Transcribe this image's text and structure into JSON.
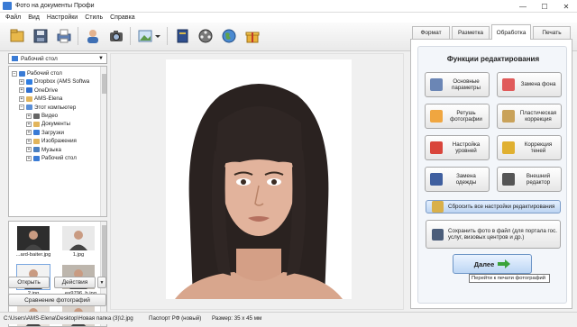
{
  "window": {
    "title": "Фото на документы Профи"
  },
  "menu": [
    "Файл",
    "Вид",
    "Настройки",
    "Стиль",
    "Справка"
  ],
  "toolbar_icons": [
    "open-icon",
    "save-icon",
    "print-icon",
    "person-icon",
    "camera-icon",
    "image-icon",
    "book-icon",
    "film-icon",
    "globe-icon",
    "gift-icon"
  ],
  "left": {
    "folder_select": "Рабочий стол",
    "tree": [
      {
        "label": "Рабочий стол",
        "indent": 0,
        "exp": "−",
        "color": "#3a7bd5"
      },
      {
        "label": "Dropbox (AMS Softwa",
        "indent": 1,
        "exp": "+",
        "color": "#2f7de1"
      },
      {
        "label": "OneDrive",
        "indent": 1,
        "exp": "+",
        "color": "#2f6fcf"
      },
      {
        "label": "AMS-Elena",
        "indent": 1,
        "exp": "+",
        "color": "#e2b55c"
      },
      {
        "label": "Этот компьютер",
        "indent": 1,
        "exp": "−",
        "color": "#5b8fd6"
      },
      {
        "label": "Видео",
        "indent": 2,
        "exp": "+",
        "color": "#666666"
      },
      {
        "label": "Документы",
        "indent": 2,
        "exp": "+",
        "color": "#e2b55c"
      },
      {
        "label": "Загрузки",
        "indent": 2,
        "exp": "+",
        "color": "#3a7bd5"
      },
      {
        "label": "Изображения",
        "indent": 2,
        "exp": "+",
        "color": "#e2b55c"
      },
      {
        "label": "Музыка",
        "indent": 2,
        "exp": "+",
        "color": "#4a7fc0"
      },
      {
        "label": "Рабочий стол",
        "indent": 2,
        "exp": "+",
        "color": "#3a7bd5"
      }
    ],
    "thumbnails": [
      {
        "caption": "...ard-baiter.jpg",
        "bg": "#2d2d2d"
      },
      {
        "caption": "1.jpg",
        "bg": "#e9e9e9"
      },
      {
        "caption": "2.jpg",
        "bg": "#f2f2f2"
      },
      {
        "caption": "...ea9796_b.jpg",
        "bg": "#bdb6ad"
      },
      {
        "caption": "",
        "bg": "#e6e0da"
      },
      {
        "caption": "",
        "bg": "#d9d2cb"
      }
    ],
    "open_btn": "Открыть",
    "actions_btn": "Действия",
    "compare_btn": "Сравнение фотографий"
  },
  "tabs": [
    "Формат",
    "Разметка",
    "Обработка",
    "Печать"
  ],
  "active_tab": "Обработка",
  "panel": {
    "title": "Функции редактирования",
    "buttons": [
      {
        "label": "Основные параметры",
        "icon": "gear-icon",
        "color": "#6b86b5"
      },
      {
        "label": "Замена фона",
        "icon": "paint-bucket-icon",
        "color": "#e05a5a"
      },
      {
        "label": "Ретушь фотографии",
        "icon": "retouch-icon",
        "color": "#f0a640"
      },
      {
        "label": "Пластическая коррекция",
        "icon": "wand-icon",
        "color": "#c9a25a"
      },
      {
        "label": "Настройка уровней",
        "icon": "levels-icon",
        "color": "#d9453b"
      },
      {
        "label": "Коррекция теней",
        "icon": "shadow-icon",
        "color": "#e0b030"
      },
      {
        "label": "Замена одежды",
        "icon": "clothes-icon",
        "color": "#3f5f9f"
      },
      {
        "label": "Внешний редактор",
        "icon": "editor-icon",
        "color": "#555555"
      }
    ],
    "reset_btn": "Сбросить все настройки редактирования",
    "save_btn": "Сохранить фото в файл (для портала гос. услуг, визовых центров и др.)"
  },
  "next_btn": "Далее",
  "tooltip": "Перейти к печати фотографий",
  "status": {
    "path": "C:\\Users\\AMS-Elena\\Desktop\\Новая папка (3)\\2.jpg",
    "format": "Паспорт РФ (новый)",
    "size": "Размер: 35 х 45 мм"
  }
}
